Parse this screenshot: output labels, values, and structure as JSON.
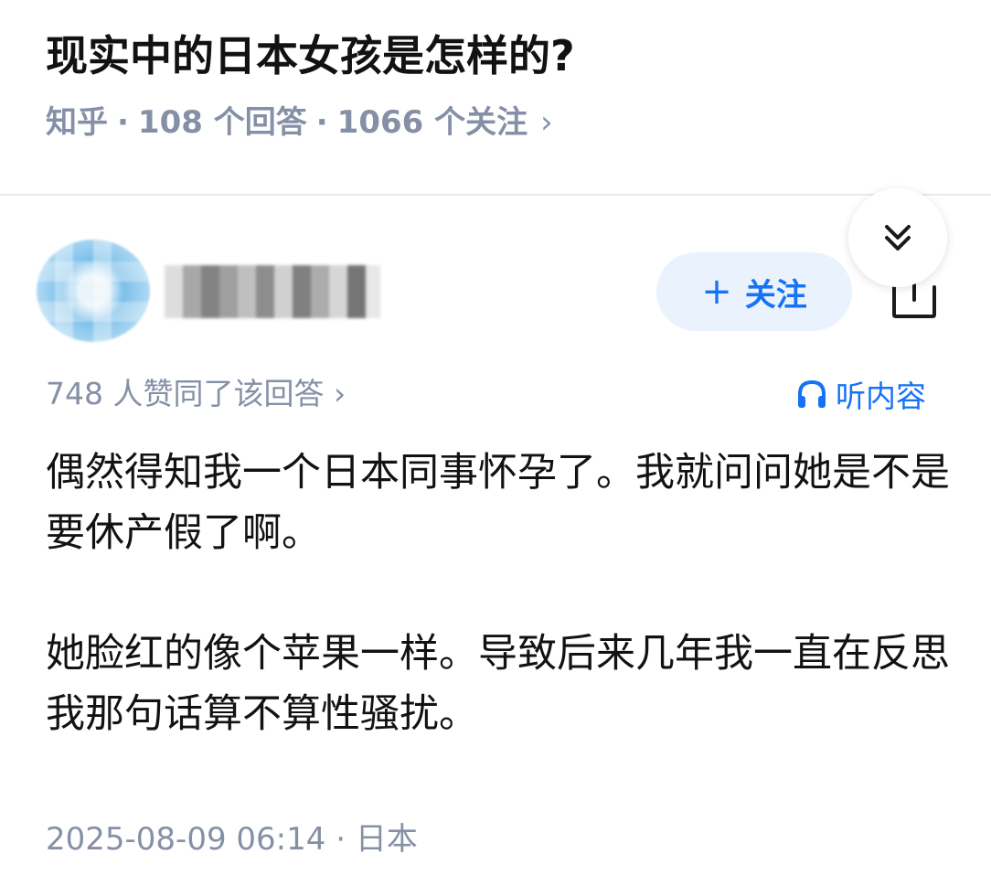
{
  "question": {
    "title": "现实中的日本女孩是怎样的?",
    "source": "知乎",
    "separator": "·",
    "answer_count": "108 个回答",
    "follower_count": "1066 个关注",
    "chevron": "›"
  },
  "author": {
    "follow_label": "关注",
    "follow_plus": "+"
  },
  "answer": {
    "votes_text": "748 人赞同了该回答",
    "votes_chevron": "›",
    "listen_label": "听内容",
    "paragraphs": [
      "偶然得知我一个日本同事怀孕了。我就问问她是不是要休产假了啊。",
      "她脸红的像个苹果一样。导致后来几年我一直在反思我那句话算不算性骚扰。"
    ],
    "date": "2025-08-09 06:14",
    "separator": "·",
    "location": "日本"
  },
  "colors": {
    "accent": "#1772f6",
    "meta_text": "#8590a6",
    "follow_bg": "#eaf2fd"
  },
  "icons": {
    "listen": "headphones-icon",
    "share": "share-icon",
    "collapse": "double-chevron-down-icon"
  }
}
